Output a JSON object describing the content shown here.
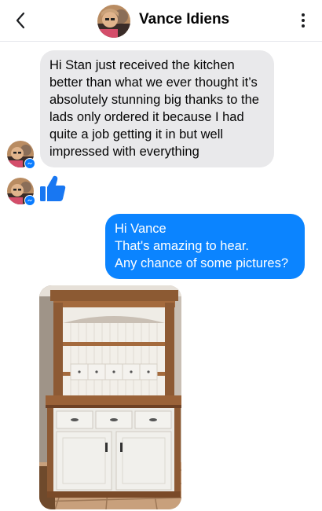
{
  "header": {
    "contact_name": "Vance Idiens",
    "back_icon": "chevron-left-icon",
    "menu_icon": "more-vertical-icon"
  },
  "conversation": {
    "incoming_message": "Hi Stan just received the kitchen better than what we ever thought it’s absolutely stunning big thanks to the lads only ordered it because I had quite a job getting it in but well impressed with everything",
    "incoming_reaction": "thumbs-up-icon",
    "outgoing_lines": [
      "Hi Vance",
      "That's amazing to hear.",
      "Any chance of some pictures?"
    ],
    "photo_subject": "kitchen-dresser-photo"
  },
  "colors": {
    "outgoing_bubble": "#0b84ff",
    "incoming_bubble": "#e9e9eb",
    "like_blue": "#1877f2",
    "badge_blue": "#0a7cff"
  }
}
